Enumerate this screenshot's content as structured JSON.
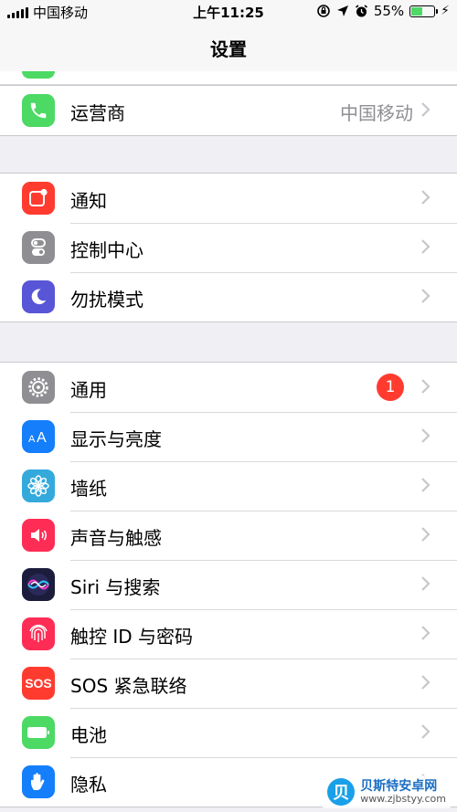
{
  "status_bar": {
    "carrier": "中国移动",
    "time": "上午11:25",
    "battery_percent": "55%",
    "battery_level": 0.55
  },
  "navbar": {
    "title": "设置"
  },
  "groups": [
    [
      {
        "label": "运营商",
        "value": "中国移动",
        "icon": "phone-icon",
        "color": "#4cd964"
      }
    ],
    [
      {
        "label": "通知",
        "icon": "notifications-icon",
        "color": "#ff3b30"
      },
      {
        "label": "控制中心",
        "icon": "control-center-icon",
        "color": "#8e8e93"
      },
      {
        "label": "勿扰模式",
        "icon": "moon-icon",
        "color": "#5856d6"
      }
    ],
    [
      {
        "label": "通用",
        "badge": "1",
        "icon": "gear-icon",
        "color": "#8e8e93"
      },
      {
        "label": "显示与亮度",
        "icon": "text-size-icon",
        "color": "#147efb"
      },
      {
        "label": "墙纸",
        "icon": "flower-icon",
        "color": "#34aadc"
      },
      {
        "label": "声音与触感",
        "icon": "speaker-icon",
        "color": "#ff2d55"
      },
      {
        "label": "Siri 与搜索",
        "icon": "siri-icon",
        "color": "#1c1c3c"
      },
      {
        "label": "触控 ID 与密码",
        "icon": "fingerprint-icon",
        "color": "#ff2d55"
      },
      {
        "label": "SOS 紧急联络",
        "icon": "sos-icon",
        "color": "#ff3b30",
        "icon_text": "SOS"
      },
      {
        "label": "电池",
        "icon": "battery-icon",
        "color": "#4cd964"
      },
      {
        "label": "隐私",
        "icon": "hand-icon",
        "color": "#147efb"
      }
    ]
  ],
  "watermark": {
    "name": "贝斯特安卓网",
    "url": "www.zjbstyy.com"
  }
}
